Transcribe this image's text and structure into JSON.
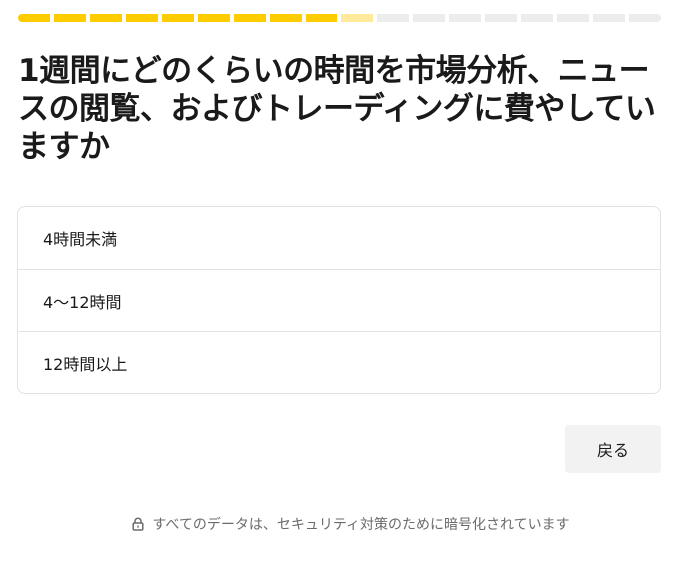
{
  "progress": {
    "total_steps": 18,
    "completed_steps": 9,
    "current_step": 10,
    "colors": {
      "done": "#ffcc00",
      "current": "#ffe99a",
      "pending": "#ececec"
    }
  },
  "question": {
    "title": "1週間にどのくらいの時間を市場分析、ニュースの閲覧、およびトレーディングに費やしていますか"
  },
  "options": [
    {
      "label": "4時間未満"
    },
    {
      "label": "4〜12時間"
    },
    {
      "label": "12時間以上"
    }
  ],
  "actions": {
    "back_label": "戻る"
  },
  "footer": {
    "lock_icon": "lock-icon",
    "security_text": "すべてのデータは、セキュリティ対策のために暗号化されています"
  }
}
